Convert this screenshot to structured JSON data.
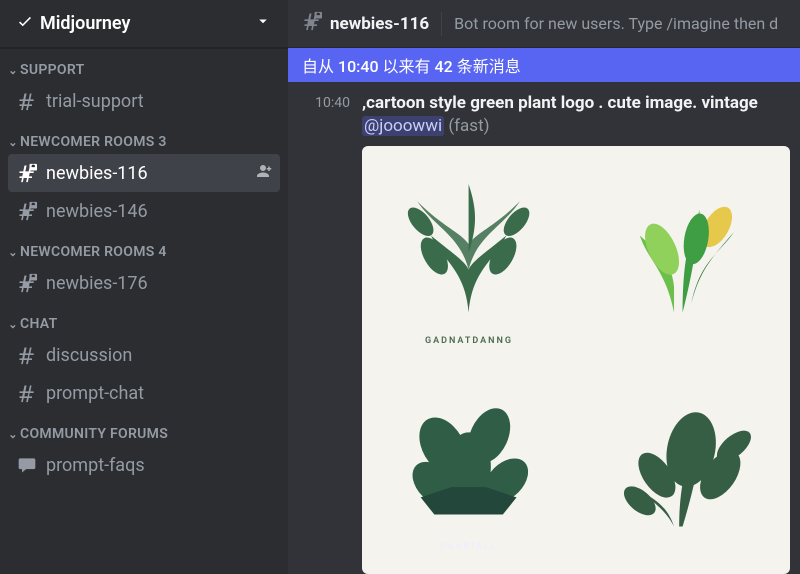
{
  "server": {
    "name": "Midjourney"
  },
  "sections": [
    {
      "label": "SUPPORT",
      "channels": [
        {
          "name": "trial-support",
          "icon": "hash",
          "active": false
        }
      ]
    },
    {
      "label": "NEWCOMER ROOMS 3",
      "channels": [
        {
          "name": "newbies-116",
          "icon": "lockhash",
          "active": true,
          "addIcon": true
        },
        {
          "name": "newbies-146",
          "icon": "lockhash",
          "active": false
        }
      ]
    },
    {
      "label": "NEWCOMER ROOMS 4",
      "channels": [
        {
          "name": "newbies-176",
          "icon": "lockhash",
          "active": false
        }
      ]
    },
    {
      "label": "CHAT",
      "channels": [
        {
          "name": "discussion",
          "icon": "hash",
          "active": false
        },
        {
          "name": "prompt-chat",
          "icon": "hash",
          "active": false
        }
      ]
    },
    {
      "label": "COMMUNITY FORUMS",
      "channels": [
        {
          "name": "prompt-faqs",
          "icon": "forum",
          "active": false
        }
      ]
    }
  ],
  "header": {
    "channel": "newbies-116",
    "topic": "Bot room for new users. Type /imagine then d"
  },
  "newMessages": "自从 10:40 以来有 42 条新消息",
  "message": {
    "time": "10:40",
    "prompt": ",cartoon style green plant logo . cute image. vintage",
    "mention": "@jooowwi",
    "suffix": "(fast)"
  },
  "imageCaptions": {
    "tl": "GADNATDANNG",
    "bl": "PAARIALL"
  }
}
